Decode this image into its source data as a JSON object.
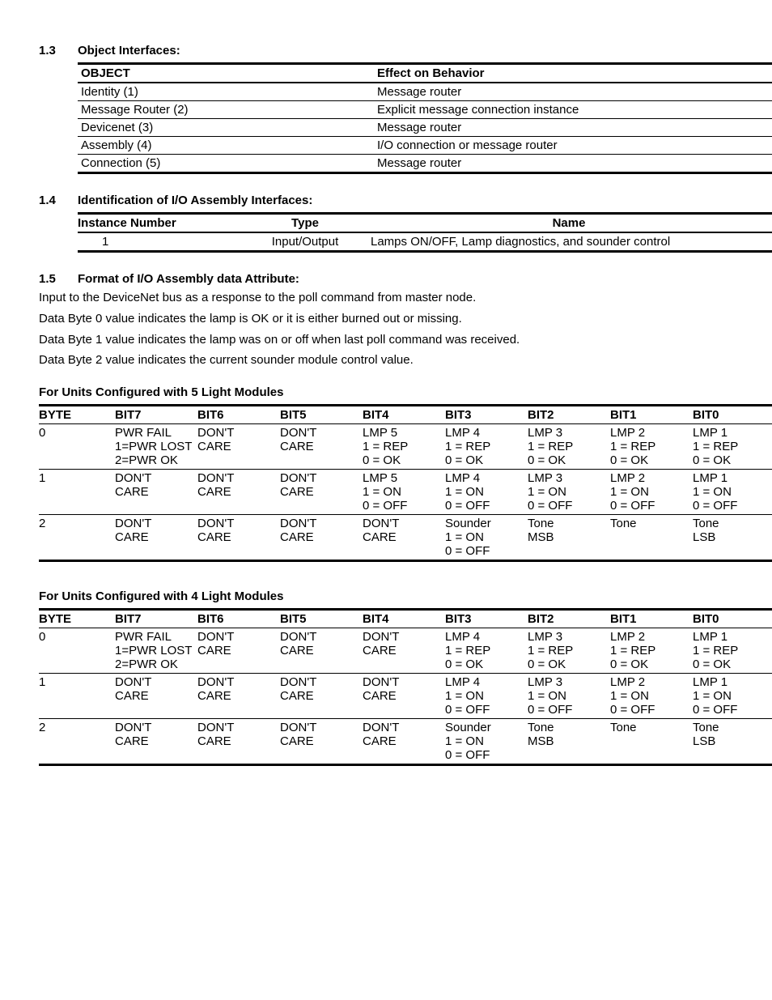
{
  "s13": {
    "num": "1.3",
    "title": "Object Interfaces:"
  },
  "t_effect": {
    "h1": "OBJECT",
    "h2": "Effect on Behavior",
    "rows": [
      {
        "a": "Identity (1)",
        "b": "Message router"
      },
      {
        "a": "Message Router (2)",
        "b": "Explicit message connection instance"
      },
      {
        "a": "Devicenet (3)",
        "b": "Message router"
      },
      {
        "a": "Assembly (4)",
        "b": "I/O connection or message router"
      },
      {
        "a": "Connection (5)",
        "b": "Message router"
      }
    ]
  },
  "s14": {
    "num": "1.4",
    "title": "Identification of I/O Assembly Interfaces:"
  },
  "t_inst": {
    "h1": "Instance Number",
    "h2": "Type",
    "h3": "Name",
    "r1": {
      "a": "1",
      "b": "Input/Output",
      "c": "Lamps ON/OFF, Lamp diagnostics, and sounder control"
    }
  },
  "s15": {
    "num": "1.5",
    "title": "Format of I/O Assembly data Attribute:",
    "p0": "Input to the DeviceNet bus as a response to the poll command from master node.",
    "p1": "Data Byte 0 value indicates the lamp is OK or it is either burned out or missing.",
    "p2": "Data Byte 1 value indicates the lamp was on or off when last poll command was received.",
    "p3": "Data Byte 2 value indicates the current sounder module control value."
  },
  "bit_hdr": {
    "byte": "BYTE",
    "b7": "BIT7",
    "b6": "BIT6",
    "b5": "BIT5",
    "b4": "BIT4",
    "b3": "BIT3",
    "b2": "BIT2",
    "b1": "BIT1",
    "b0": "BIT0"
  },
  "sub5": "For Units Configured with 5 Light Modules",
  "t5": [
    {
      "byte": "0",
      "b7": "PWR FAIL\n1=PWR LOST\n2=PWR OK",
      "b6": "DON'T\nCARE",
      "b5": "DON'T\nCARE",
      "b4": "LMP 5\n1 = REP\n0 = OK",
      "b3": "LMP 4\n1 = REP\n0 = OK",
      "b2": "LMP 3\n1 = REP\n0 = OK",
      "b1": "LMP 2\n1 = REP\n0 = OK",
      "b0": "LMP 1\n1 = REP\n0 = OK"
    },
    {
      "byte": "1",
      "b7": "DON'T\nCARE",
      "b6": "DON'T\nCARE",
      "b5": "DON'T\nCARE",
      "b4": "LMP 5\n1 = ON\n0 = OFF",
      "b3": "LMP 4\n1 = ON\n0 = OFF",
      "b2": "LMP 3\n1 = ON\n0 = OFF",
      "b1": "LMP 2\n1 = ON\n0 = OFF",
      "b0": "LMP 1\n1 = ON\n0 = OFF"
    },
    {
      "byte": "2",
      "b7": "DON'T\nCARE",
      "b6": "DON'T\nCARE",
      "b5": "DON'T\nCARE",
      "b4": "DON'T\nCARE",
      "b3": "Sounder\n1 = ON\n0 = OFF",
      "b2": "Tone\nMSB",
      "b1": "Tone",
      "b0": "Tone\nLSB"
    }
  ],
  "sub4": "For Units Configured with 4 Light Modules",
  "t4": [
    {
      "byte": "0",
      "b7": "PWR FAIL\n1=PWR LOST\n2=PWR OK",
      "b6": "DON'T\nCARE",
      "b5": "DON'T\nCARE",
      "b4": "DON'T\nCARE",
      "b3": "LMP 4\n1 = REP\n0 = OK",
      "b2": "LMP 3\n1 = REP\n0 = OK",
      "b1": "LMP 2\n1 = REP\n0 = OK",
      "b0": "LMP 1\n1 = REP\n0 = OK"
    },
    {
      "byte": "1",
      "b7": "DON'T\nCARE",
      "b6": "DON'T\nCARE",
      "b5": "DON'T\nCARE",
      "b4": "DON'T\nCARE",
      "b3": "LMP 4\n1 = ON\n0 = OFF",
      "b2": "LMP 3\n1 = ON\n0 = OFF",
      "b1": "LMP 2\n1 = ON\n0 = OFF",
      "b0": "LMP 1\n1 = ON\n0 = OFF"
    },
    {
      "byte": "2",
      "b7": "DON'T\nCARE",
      "b6": "DON'T\nCARE",
      "b5": "DON'T\nCARE",
      "b4": "DON'T\nCARE",
      "b3": "Sounder\n1 = ON\n0 = OFF",
      "b2": "Tone\nMSB",
      "b1": "Tone",
      "b0": "Tone\nLSB"
    }
  ]
}
